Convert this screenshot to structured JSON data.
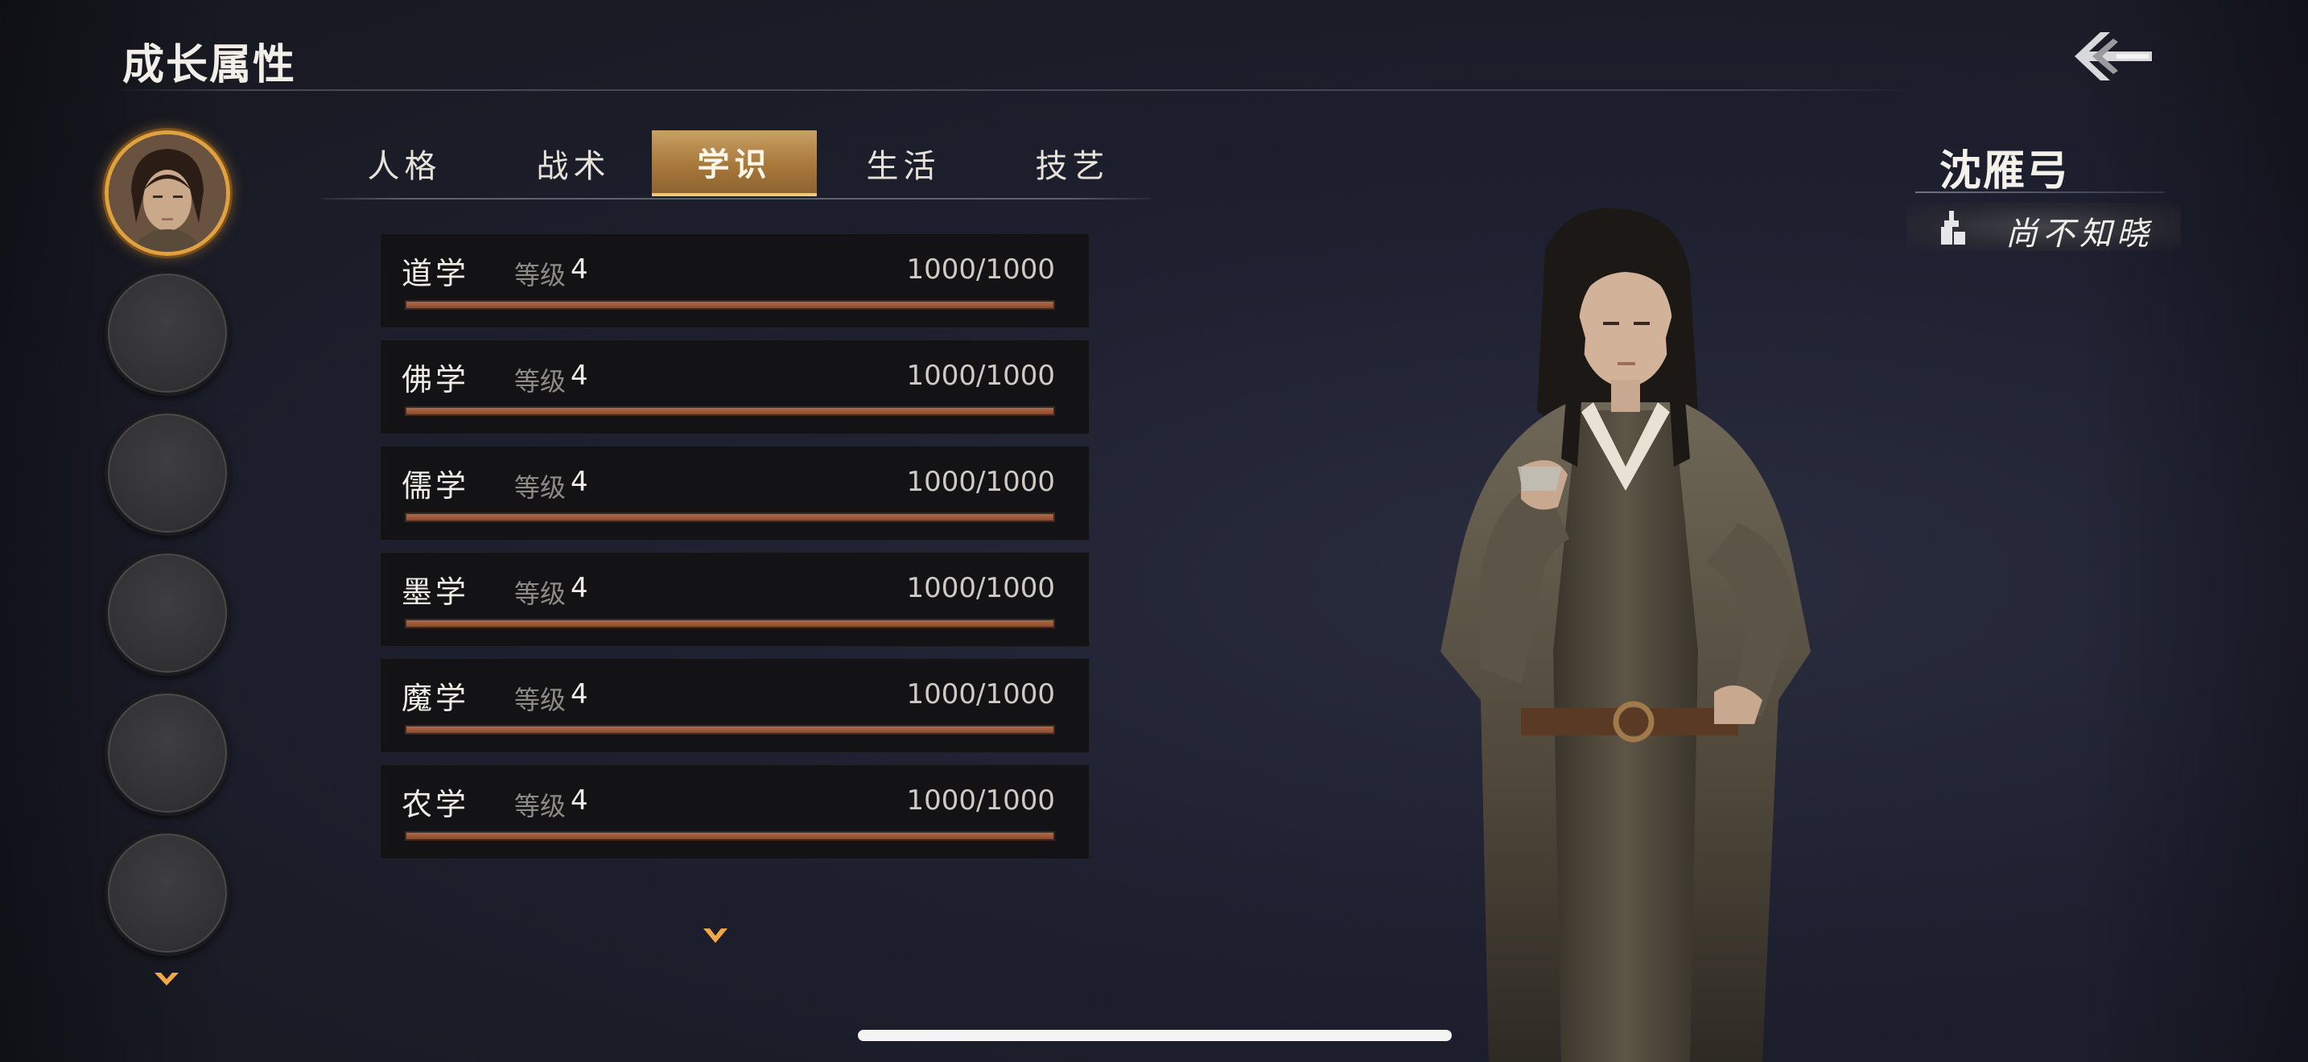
{
  "header": {
    "title": "成长属性"
  },
  "icons": {
    "back": "back-arrow-icon",
    "more": "chevron-down-icon",
    "motto": "tower-icon"
  },
  "colors": {
    "accent": "#e0a140",
    "tab_active": "#b88848",
    "bar_fill": "#a05c3c"
  },
  "characters": {
    "slot_count": 6,
    "active_index": 0
  },
  "tabs": [
    {
      "label": "人格",
      "active": false
    },
    {
      "label": "战术",
      "active": false
    },
    {
      "label": "学识",
      "active": true
    },
    {
      "label": "生活",
      "active": false
    },
    {
      "label": "技艺",
      "active": false
    }
  ],
  "attributes": [
    {
      "name": "道学",
      "level_label": "等级",
      "level": "4",
      "progress_text": "1000/1000",
      "fill": 1.0
    },
    {
      "name": "佛学",
      "level_label": "等级",
      "level": "4",
      "progress_text": "1000/1000",
      "fill": 1.0
    },
    {
      "name": "儒学",
      "level_label": "等级",
      "level": "4",
      "progress_text": "1000/1000",
      "fill": 1.0
    },
    {
      "name": "墨学",
      "level_label": "等级",
      "level": "4",
      "progress_text": "1000/1000",
      "fill": 1.0
    },
    {
      "name": "魔学",
      "level_label": "等级",
      "level": "4",
      "progress_text": "1000/1000",
      "fill": 1.0
    },
    {
      "name": "农学",
      "level_label": "等级",
      "level": "4",
      "progress_text": "1000/1000",
      "fill": 1.0
    }
  ],
  "character": {
    "name": "沈雁弓",
    "motto": "尚不知晓"
  }
}
